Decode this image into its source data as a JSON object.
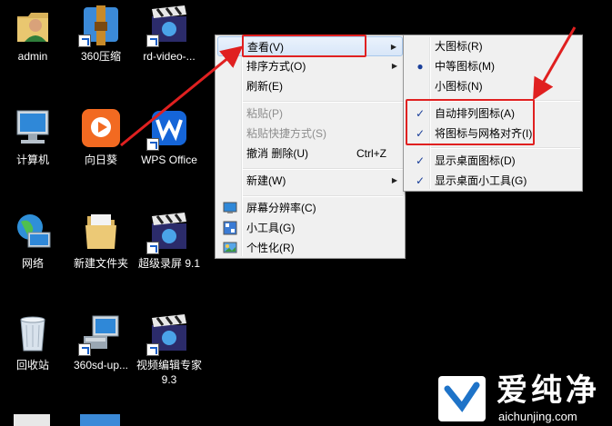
{
  "desktop": {
    "icons": [
      {
        "label": "admin"
      },
      {
        "label": "360压缩"
      },
      {
        "label": "rd-video-..."
      },
      {
        "label": "计算机"
      },
      {
        "label": "向日葵"
      },
      {
        "label": "WPS Office"
      },
      {
        "label": "网络"
      },
      {
        "label": "新建文件夹"
      },
      {
        "label": "超级录屏 9.1"
      },
      {
        "label": "回收站"
      },
      {
        "label": "360sd-up..."
      },
      {
        "label": "视频编辑专家 9.3"
      }
    ]
  },
  "context_menu": {
    "items": {
      "view": "查看(V)",
      "sort": "排序方式(O)",
      "refresh": "刷新(E)",
      "paste": "粘贴(P)",
      "paste_shortcut": "粘贴快捷方式(S)",
      "undo_delete": "撤消 删除(U)",
      "undo_shortcut": "Ctrl+Z",
      "new": "新建(W)",
      "resolution": "屏幕分辨率(C)",
      "gadgets": "小工具(G)",
      "personalize": "个性化(R)"
    }
  },
  "view_submenu": {
    "items": {
      "large": "大图标(R)",
      "medium": "中等图标(M)",
      "small": "小图标(N)",
      "auto_arrange": "自动排列图标(A)",
      "align_grid": "将图标与网格对齐(I)",
      "show_icons": "显示桌面图标(D)",
      "show_gadgets": "显示桌面小工具(G)"
    }
  },
  "watermark": {
    "brand": "爱纯净",
    "url": "aichunjing.com"
  },
  "colors": {
    "annotation_red": "#e02020",
    "check_blue": "#1a3f9a"
  }
}
